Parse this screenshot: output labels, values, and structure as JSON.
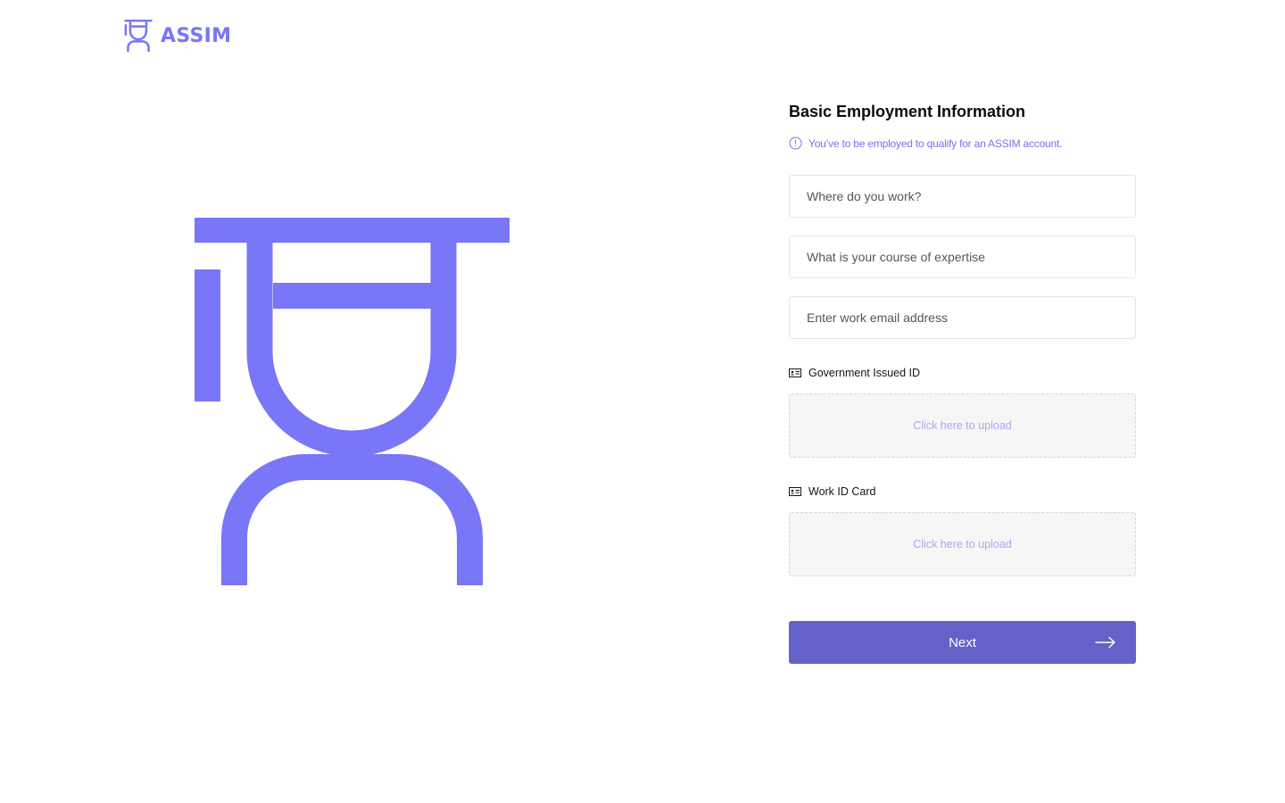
{
  "brand": {
    "name": "ASSIM",
    "accent": "#7976f7",
    "logo_icon": "assim-logo-icon"
  },
  "form": {
    "title": "Basic Employment Information",
    "notice": {
      "icon": "info-circle-icon",
      "text": "You’ve to be employed to qualify for an ASSIM account."
    },
    "fields": {
      "workplace_placeholder": "Where do you work?",
      "expertise_placeholder": "What is your course of expertise",
      "email_placeholder": "Enter work email address"
    },
    "uploads": [
      {
        "icon": "id-card-icon",
        "label": "Government Issued ID",
        "action": "Click here to upload"
      },
      {
        "icon": "id-card-icon",
        "label": "Work ID Card",
        "action": "Click here to upload"
      }
    ],
    "next": {
      "label": "Next",
      "icon": "arrow-right-icon",
      "color": "#6461c9"
    }
  }
}
